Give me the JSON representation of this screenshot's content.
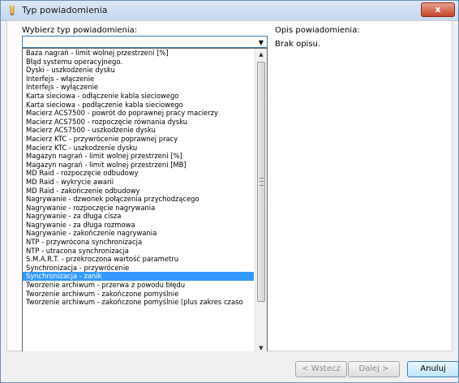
{
  "window": {
    "title": "Typ powiadomienia",
    "close_label": "x"
  },
  "form": {
    "type_label": "Wybierz typ powiadomienia:",
    "combo_value": "",
    "description_label": "Opis powiadomienia:",
    "description_text": "Brak opisu."
  },
  "dropdown": {
    "selected_index": 29,
    "items": [
      {
        "label": "Baza nagrań - limit wolnej przestrzeni [%]"
      },
      {
        "label": "Błąd systemu operacyjnego."
      },
      {
        "label": "Dyski - uszkodzenie dysku"
      },
      {
        "label": "Interfejs - włączenie"
      },
      {
        "label": "Interfejs - wyłączenie"
      },
      {
        "label": "Karta sieciowa - odłączenie kabla sieciowego"
      },
      {
        "label": "Karta sieciowa - podłączenie kabla sieciowego"
      },
      {
        "label": "Macierz ACS7500 - powrót do poprawnej pracy macierzy"
      },
      {
        "label": "Macierz ACS7500 - rozpoczęcie równania dysku"
      },
      {
        "label": "Macierz ACS7500 - uszkodzenie dysku"
      },
      {
        "label": "Macierz KTC - przywrócenie poprawnej pracy"
      },
      {
        "label": "Macierz KTC - uszkodzenie dysku"
      },
      {
        "label": "Magazyn nagrań - limit wolnej przestrzeni [%]"
      },
      {
        "label": "Magazyn nagrań - limit wolnej przestrzeni [MB]"
      },
      {
        "label": "MD Raid - rozpoczęcie odbudowy"
      },
      {
        "label": "MD Raid - wykrycie awarii"
      },
      {
        "label": "MD Raid - zakończenie odbudowy"
      },
      {
        "label": "Nagrywanie - dzwonek połączenia przychodzącego"
      },
      {
        "label": "Nagrywanie - rozpoczęcie nagrywania"
      },
      {
        "label": "Nagrywanie - za długa cisza"
      },
      {
        "label": "Nagrywanie - za długa rozmowa"
      },
      {
        "label": "Nagrywanie - zakończenie nagrywania"
      },
      {
        "label": "NTP - przywrócona synchronizacja"
      },
      {
        "label": "NTP - utracona synchronizacja"
      },
      {
        "label": "S.M.A.R.T. - przekroczona wartość parametru"
      },
      {
        "label": "Synchronizacja - przywrócenie"
      },
      {
        "label": "Synchronizacja - zanik"
      },
      {
        "label": "Tworzenie archiwum - przerwa z powodu błędu"
      },
      {
        "label": "Tworzenie archiwum - zakończone pomyślnie"
      },
      {
        "label": "Tworzenie archiwum - zakończone pomyślnie (plus zakres czaso"
      }
    ]
  },
  "buttons": {
    "back": "< Wstecz",
    "next": "Dalej >",
    "cancel": "Anuluj"
  },
  "icons": {
    "title_icon": "wizard-icon",
    "combo_arrow": "chevron-down-icon",
    "scroll_up": "scroll-up-icon",
    "scroll_down": "scroll-down-icon"
  }
}
